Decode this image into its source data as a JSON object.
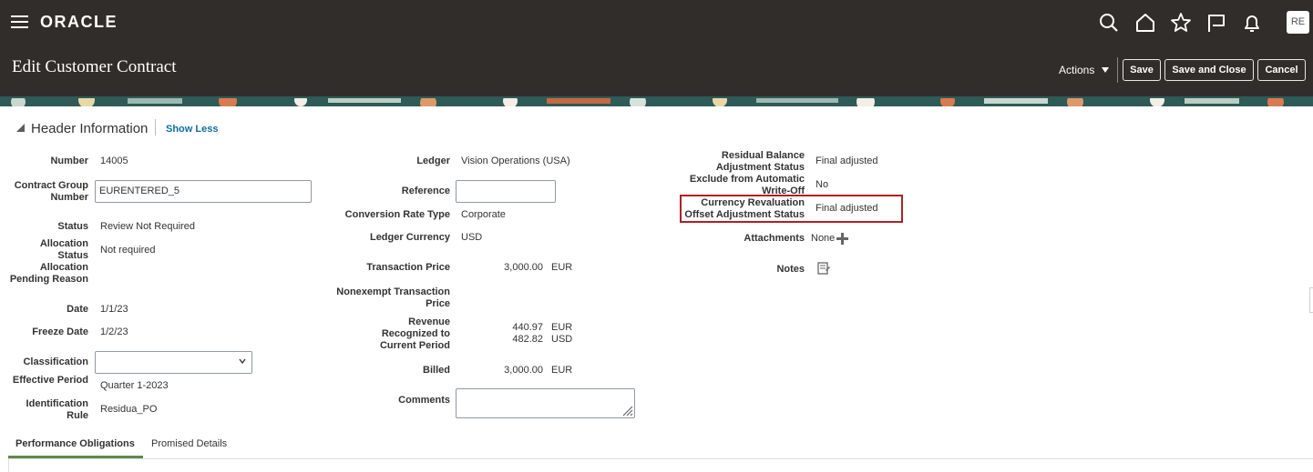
{
  "app": {
    "logo": "ORACLE",
    "avatar_initials": "RE"
  },
  "page": {
    "title": "Edit Customer Contract"
  },
  "toolbar": {
    "actions_label": "Actions",
    "save_label": "Save",
    "save_close_label": "Save and Close",
    "cancel_label": "Cancel"
  },
  "icons": [
    "menu-icon",
    "search-icon",
    "home-icon",
    "favorites-star-icon",
    "notifications-flag-icon",
    "bell-icon"
  ],
  "section": {
    "title": "Header Information",
    "toggle_link": "Show Less"
  },
  "left": {
    "number_label": "Number",
    "number_value": "14005",
    "contract_group_label": "Contract Group Number",
    "contract_group_value": "EURENTERED_5",
    "status_label": "Status",
    "status_value": "Review Not Required",
    "allocation_status_label": "Allocation Status",
    "allocation_status_value": "Not required",
    "allocation_pending_label": "Allocation Pending Reason",
    "date_label": "Date",
    "date_value": "1/1/23",
    "freeze_date_label": "Freeze Date",
    "freeze_date_value": "1/2/23",
    "classification_label": "Classification",
    "classification_value": "",
    "effective_period_label": "Effective Period",
    "effective_period_value": "Quarter 1-2023",
    "identification_rule_label": "Identification Rule",
    "identification_rule_value": "Residua_PO"
  },
  "middle": {
    "ledger_label": "Ledger",
    "ledger_value": "Vision Operations (USA)",
    "reference_label": "Reference",
    "reference_value": "",
    "conversion_rate_type_label": "Conversion Rate Type",
    "conversion_rate_type_value": "Corporate",
    "ledger_currency_label": "Ledger Currency",
    "ledger_currency_value": "USD",
    "transaction_price_label": "Transaction Price",
    "transaction_price_amount": "3,000.00",
    "transaction_price_currency": "EUR",
    "nonexempt_label": "Nonexempt Transaction Price",
    "revenue_label": "Revenue Recognized to Current Period",
    "revenue_amount_1": "440.97",
    "revenue_currency_1": "EUR",
    "revenue_amount_2": "482.82",
    "revenue_currency_2": "USD",
    "billed_label": "Billed",
    "billed_amount": "3,000.00",
    "billed_currency": "EUR",
    "comments_label": "Comments",
    "comments_value": ""
  },
  "right": {
    "residual_balance_label": "Residual Balance Adjustment Status",
    "residual_balance_value": "Final adjusted",
    "exclude_label": "Exclude from Automatic Write-Off",
    "exclude_value": "No",
    "currency_revaluation_label": "Currency Revaluation Offset Adjustment Status",
    "currency_revaluation_value": "Final adjusted",
    "attachments_label": "Attachments",
    "attachments_value": "None",
    "notes_label": "Notes"
  },
  "tabs": [
    {
      "label": "Performance Obligations",
      "active": true
    },
    {
      "label": "Promised Details",
      "active": false
    }
  ],
  "colors": {
    "topbar": "#312d2a",
    "link": "#0b6ea6",
    "highlight": "#b31f23",
    "tab_accent": "#5c8a4b"
  }
}
